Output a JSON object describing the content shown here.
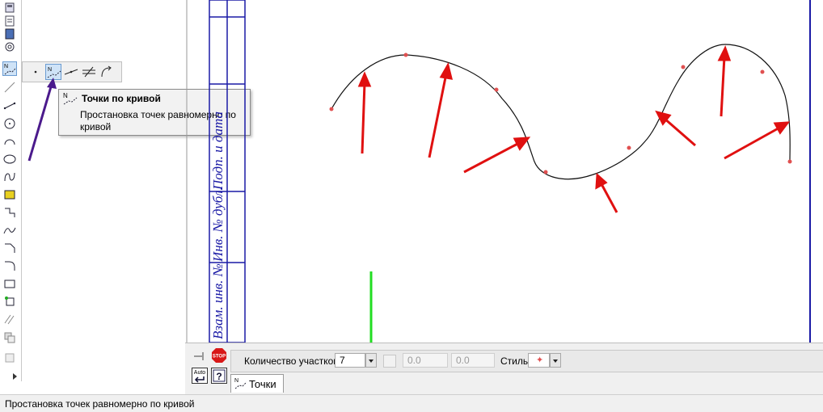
{
  "tooltip": {
    "title": "Точки по кривой",
    "description": "Простановка точек равномерно по кривой",
    "icon_letter": "N"
  },
  "params": {
    "segments_label": "Количество участков",
    "segments_value": "7",
    "field_a_value": "0.0",
    "field_b_value": "0.0",
    "style_label": "Стиль"
  },
  "panel": {
    "stop_label": "STOP",
    "auto_label": "Auto",
    "help_label": "?",
    "tab_label": "Точки",
    "tab_icon_letter": "N"
  },
  "toolbar": {
    "active_icon_letter": "N"
  },
  "title_block": {
    "labels": [
      "Подп. и дата",
      "Инв. № дубл.",
      "Взам. инв. №"
    ]
  },
  "status": {
    "text": "Простановка точек равномерно по кривой"
  },
  "colors": {
    "frame": "#1a1aa6",
    "arrow_red": "#e01010",
    "arrow_green": "#22dd22",
    "arrow_purple": "#4b1a8c",
    "point": "#e05050"
  }
}
